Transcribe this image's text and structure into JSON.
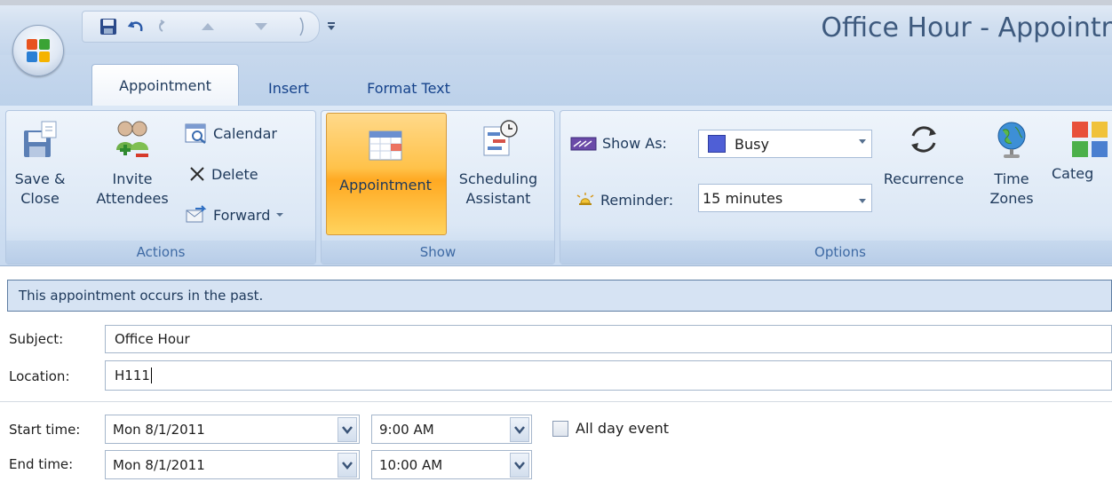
{
  "window": {
    "title": "Office Hour - Appointr"
  },
  "quick_access": {
    "icons": [
      "save-icon",
      "undo-icon",
      "redo-icon",
      "up-arrow-icon",
      "down-arrow-icon",
      "customize-qat-icon"
    ]
  },
  "tabs": [
    {
      "label": "Appointment",
      "active": true
    },
    {
      "label": "Insert",
      "active": false
    },
    {
      "label": "Format Text",
      "active": false
    }
  ],
  "ribbon": {
    "actions": {
      "label": "Actions",
      "save_close": "Save & Close",
      "save_close_line1": "Save &",
      "save_close_line2": "Close",
      "invite_line1": "Invite",
      "invite_line2": "Attendees",
      "calendar": "Calendar",
      "delete": "Delete",
      "forward": "Forward"
    },
    "show": {
      "label": "Show",
      "appointment": "Appointment",
      "scheduling_line1": "Scheduling",
      "scheduling_line2": "Assistant"
    },
    "options": {
      "label": "Options",
      "show_as_label": "Show As:",
      "show_as_value": "Busy",
      "reminder_label": "Reminder:",
      "reminder_value": "15 minutes",
      "recurrence": "Recurrence",
      "time_line1": "Time",
      "time_line2": "Zones",
      "categorize": "Categ"
    }
  },
  "infobar": {
    "text": "This appointment occurs in the past."
  },
  "form": {
    "subject_label": "Subject:",
    "subject_value": "Office Hour",
    "location_label": "Location:",
    "location_value": "H111",
    "start_label": "Start time:",
    "start_date": "Mon 8/1/2011",
    "start_time": "9:00 AM",
    "end_label": "End time:",
    "end_date": "Mon 8/1/2011",
    "end_time": "10:00 AM",
    "all_day_label": "All day event",
    "all_day_checked": false
  },
  "colors": {
    "busy": "#4f5fd6",
    "active_button": "#ffc24a"
  }
}
